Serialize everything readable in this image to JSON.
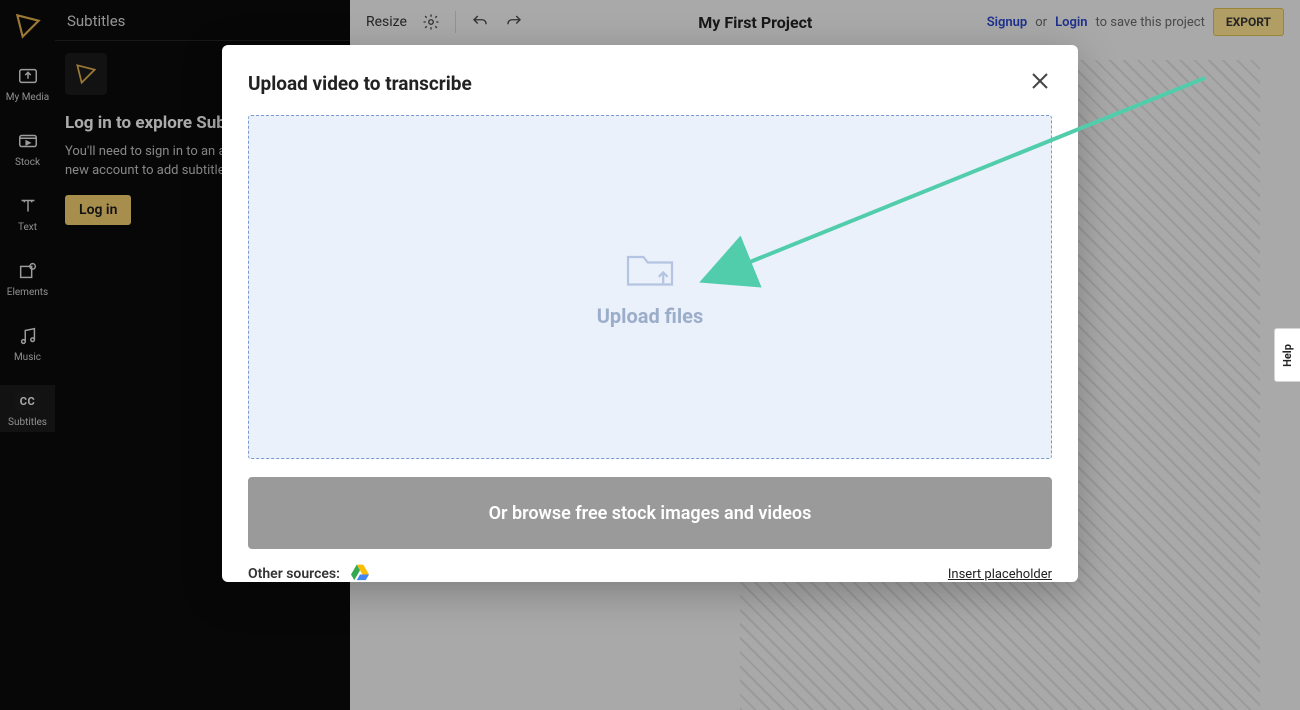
{
  "rail": {
    "items": [
      {
        "label": "My Media"
      },
      {
        "label": "Stock"
      },
      {
        "label": "Text"
      },
      {
        "label": "Elements"
      },
      {
        "label": "Music"
      },
      {
        "label": "Subtitles"
      }
    ]
  },
  "sidePanel": {
    "title": "Subtitles",
    "heading": "Log in to explore Subtitles",
    "description": "You'll need to sign in to an account or create a new account to add subtitles to video.",
    "loginLabel": "Log in"
  },
  "topbar": {
    "resize": "Resize",
    "projectTitle": "My First Project",
    "signup": "Signup",
    "or": "or",
    "login": "Login",
    "tail": "to save this project",
    "export": "EXPORT"
  },
  "modal": {
    "title": "Upload video to transcribe",
    "dropLabel": "Upload files",
    "stockButton": "Or browse free stock images and videos",
    "otherSources": "Other sources:",
    "sources": {
      "gdrive": "google-drive-icon"
    },
    "insertPlaceholder": "Insert placeholder"
  },
  "help": {
    "label": "Help"
  }
}
